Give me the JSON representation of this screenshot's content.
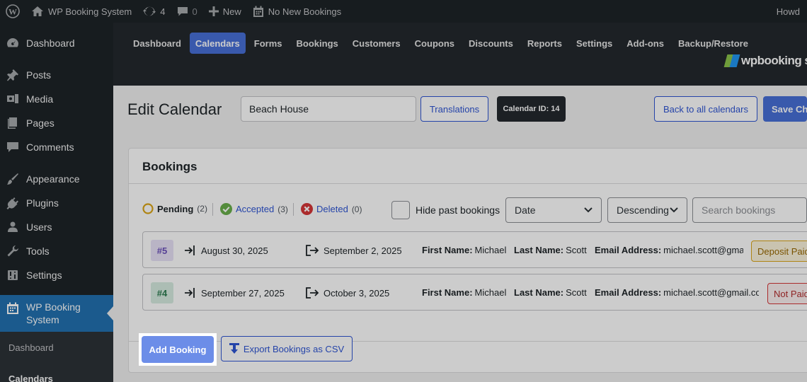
{
  "adminbar": {
    "site_name": "WP Booking System",
    "updates_count": "4",
    "comments_count": "0",
    "new_label": "New",
    "bookings_notice": "No New Bookings",
    "howdy": "Howd"
  },
  "sidebar": {
    "items": [
      {
        "label": "Dashboard",
        "icon": "dashboard-icon"
      },
      {
        "label": "Posts",
        "icon": "pin-icon"
      },
      {
        "label": "Media",
        "icon": "media-icon"
      },
      {
        "label": "Pages",
        "icon": "pages-icon"
      },
      {
        "label": "Comments",
        "icon": "comment-icon"
      },
      {
        "label": "Appearance",
        "icon": "brush-icon"
      },
      {
        "label": "Plugins",
        "icon": "plugin-icon"
      },
      {
        "label": "Users",
        "icon": "user-icon"
      },
      {
        "label": "Tools",
        "icon": "wrench-icon"
      },
      {
        "label": "Settings",
        "icon": "settings-icon"
      },
      {
        "label": "WP Booking System",
        "icon": "calendar-icon"
      }
    ],
    "submenu": [
      "Dashboard",
      "Calendars"
    ]
  },
  "plugin_nav": {
    "tabs": [
      "Dashboard",
      "Calendars",
      "Forms",
      "Bookings",
      "Customers",
      "Coupons",
      "Discounts",
      "Reports",
      "Settings",
      "Add-ons",
      "Backup/Restore"
    ],
    "active": "Calendars",
    "logo_text": "wpbooking s"
  },
  "header": {
    "title": "Edit Calendar",
    "calendar_name": "Beach House",
    "translations_label": "Translations",
    "calendar_id_label": "Calendar ID: 14",
    "back_label": "Back to all calendars",
    "save_label": "Save Cha"
  },
  "bookings": {
    "title": "Bookings",
    "status": {
      "pending": {
        "label": "Pending",
        "count": "(2)"
      },
      "accepted": {
        "label": "Accepted",
        "count": "(3)"
      },
      "deleted": {
        "label": "Deleted",
        "count": "(0)"
      }
    },
    "hide_past_label": "Hide past bookings",
    "sort_field": "Date",
    "sort_order": "Descending",
    "search_placeholder": "Search bookings",
    "rows": [
      {
        "id": "#5",
        "checkin": "August 30, 2025",
        "checkout": "September 2, 2025",
        "first_name_label": "First Name:",
        "first_name": "Michael",
        "last_name_label": "Last Name:",
        "last_name": "Scott",
        "email_label": "Email Address:",
        "email": "michael.scott@gmail.com",
        "payment": "Deposit Paid"
      },
      {
        "id": "#4",
        "checkin": "September 27, 2025",
        "checkout": "October 3, 2025",
        "first_name_label": "First Name:",
        "first_name": "Michael",
        "last_name_label": "Last Name:",
        "last_name": "Scott",
        "email_label": "Email Address:",
        "email": "michael.scott@gmail.com",
        "payment": "Not Paid"
      }
    ],
    "add_label": "Add Booking",
    "export_label": "Export Bookings as CSV"
  },
  "colors": {
    "accent": "#4870d8",
    "pending": "#dba617",
    "accepted": "#6ab04c",
    "deleted": "#d63638"
  }
}
